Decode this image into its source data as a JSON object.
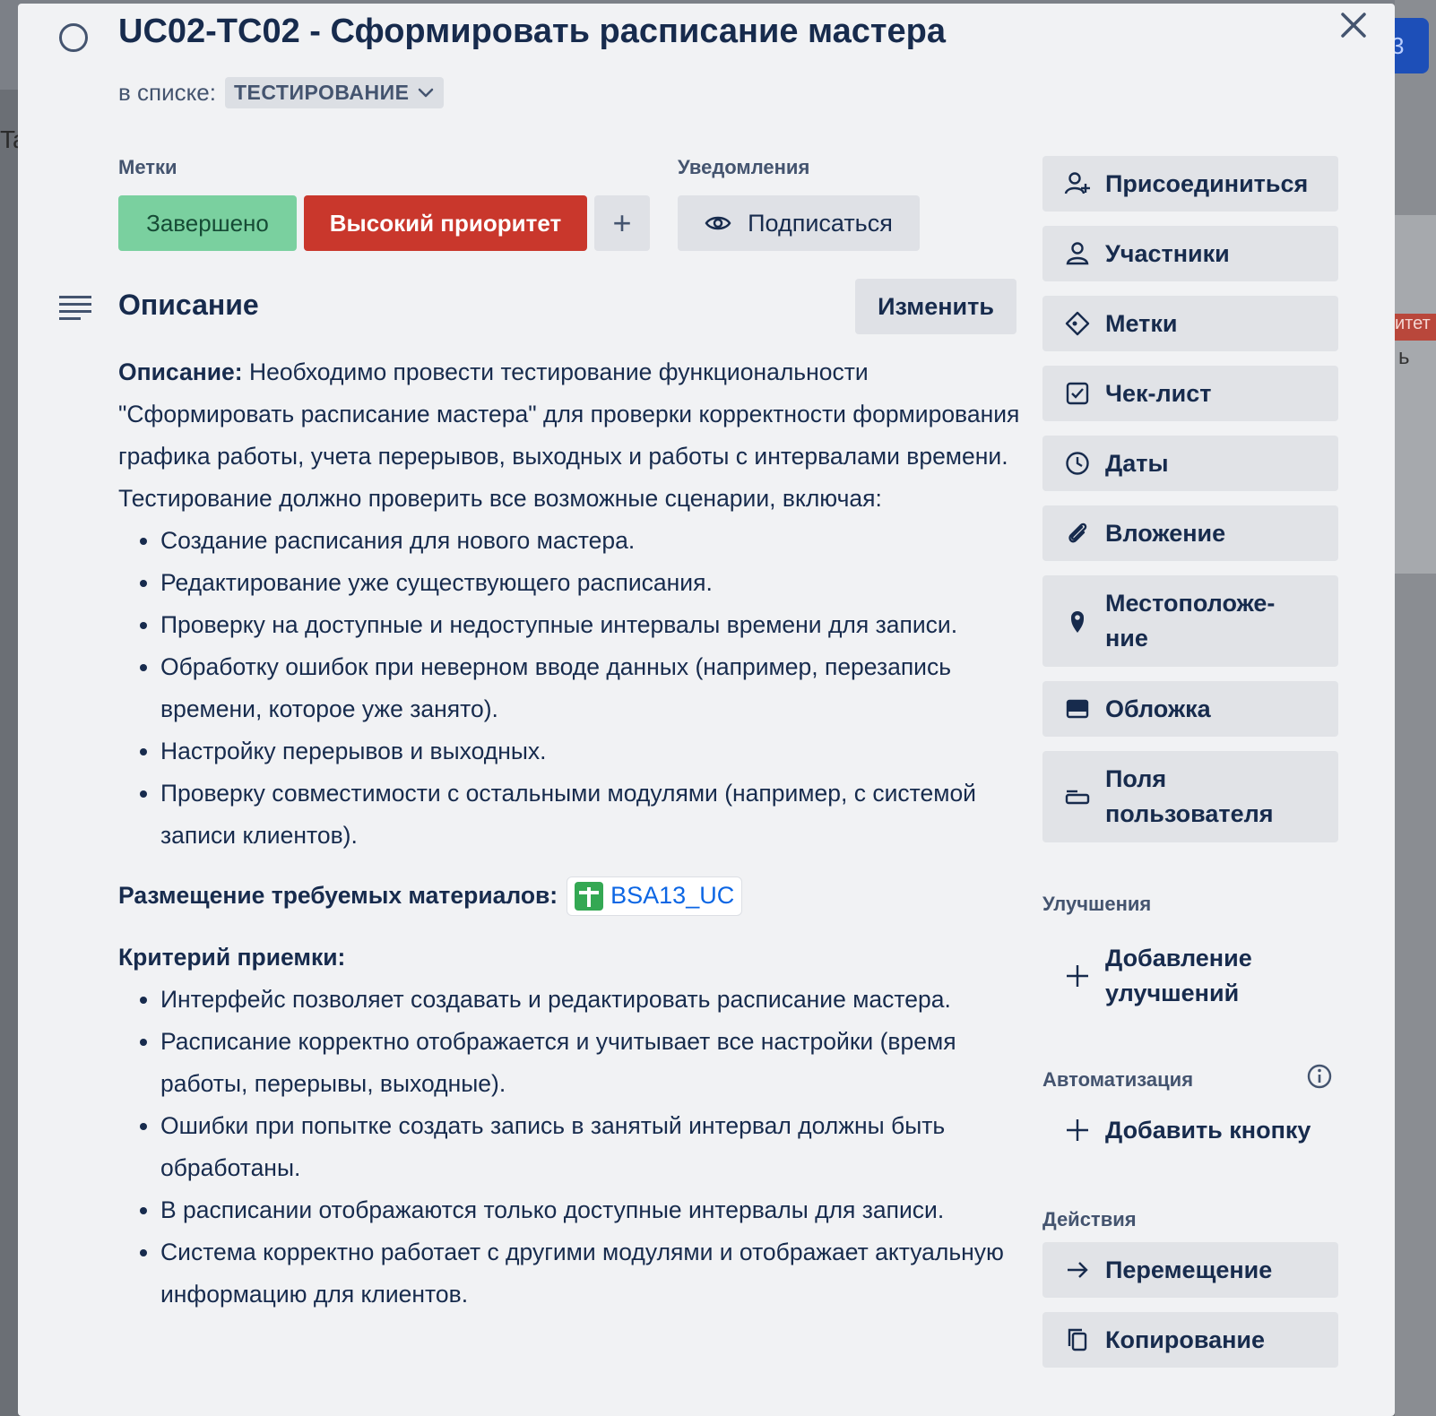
{
  "background": {
    "left_text": "Ta",
    "right_button_text": "3",
    "right_label_text": "итет",
    "right_text": "ь"
  },
  "card": {
    "title": "UC02-TC02 - Сформировать расписание мастера",
    "in_list_prefix": "в списке:",
    "list_name": "ТЕСТИРОВАНИЕ"
  },
  "labels": {
    "heading": "Метки",
    "items": [
      {
        "text": "Завершено",
        "color": "#7ad09f"
      },
      {
        "text": "Высокий приоритет",
        "color": "#c9372c"
      }
    ],
    "add": "+"
  },
  "notifications": {
    "heading": "Уведомления",
    "subscribe": "Подписаться"
  },
  "description": {
    "heading": "Описание",
    "edit": "Изменить",
    "intro_bold": "Описание:",
    "intro": " Необходимо провести тестирование функциональности \"Сформировать расписание мастера\" для проверки корректности формирования графика работы, учета перерывов, выходных и работы с интервалами времени. Тестирование должно проверить все возможные сценарии, включая:",
    "scenarios": [
      "Создание расписания для нового мастера.",
      "Редактирование уже существующего расписания.",
      "Проверку на доступные и недоступные интервалы времени для записи.",
      "Обработку ошибок при неверном вводе данных (например, перезапись времени, которое уже занято).",
      "Настройку перерывов и выходных.",
      "Проверку совместимости с остальными модулями (например, с системой записи клиентов)."
    ],
    "materials_label": "Размещение требуемых материалов:",
    "materials_link": "BSA13_UC",
    "criteria_heading": "Критерий приемки:",
    "criteria": [
      "Интерфейс позволяет создавать и редактировать расписание мастера.",
      "Расписание корректно отображается и учитывает все настройки (время работы, перерывы, выходные).",
      "Ошибки при попытке создать запись в занятый интервал должны быть обработаны.",
      "В расписании отображаются только доступные интервалы для записи.",
      "Система корректно работает с другими модулями и отображает актуальную информацию для клиентов."
    ]
  },
  "sidebar": {
    "buttons": [
      {
        "label": "Присоединиться",
        "icon": "add-person-icon"
      },
      {
        "label": "Участники",
        "icon": "person-icon"
      },
      {
        "label": "Метки",
        "icon": "tag-icon"
      },
      {
        "label": "Чек-лист",
        "icon": "checkbox-icon"
      },
      {
        "label": "Даты",
        "icon": "clock-icon"
      },
      {
        "label": "Вложение",
        "icon": "paperclip-icon"
      },
      {
        "label": "Местоположе-ние",
        "line1": "Местоположе-",
        "line2": "ние",
        "icon": "location-pin-icon"
      },
      {
        "label": "Обложка",
        "icon": "cover-icon"
      },
      {
        "label": "Поля пользователя",
        "line1": "Поля",
        "line2": "пользователя",
        "icon": "custom-fields-icon"
      }
    ],
    "powerups_heading": "Улучшения",
    "add_powerups_line1": "Добавление",
    "add_powerups_line2": "улучшений",
    "automation_heading": "Автоматизация",
    "add_button": "Добавить кнопку",
    "actions_heading": "Действия",
    "move": "Перемещение",
    "copy": "Копирование"
  }
}
